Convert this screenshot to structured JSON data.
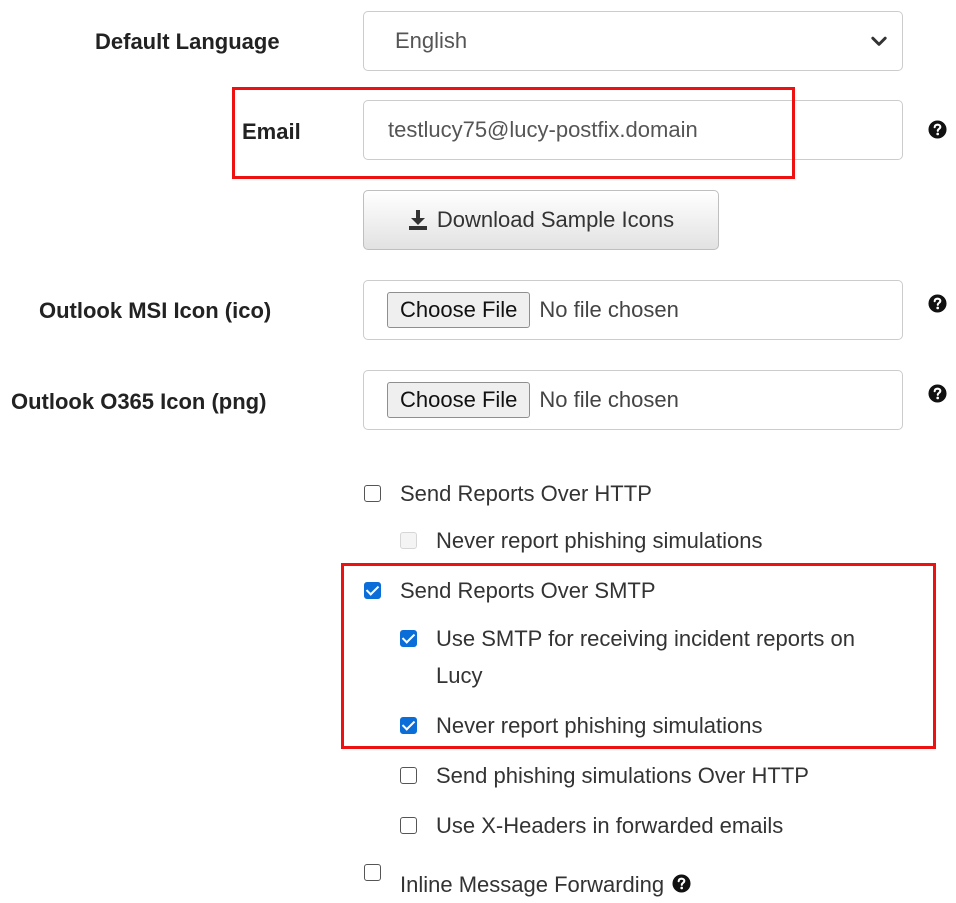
{
  "form": {
    "language": {
      "label": "Default Language",
      "value": "English"
    },
    "email": {
      "label": "Email",
      "value": "testlucy75@lucy-postfix.domain"
    },
    "download_button": {
      "label": "Download Sample Icons",
      "icon": "download-icon"
    },
    "msi_icon": {
      "label": "Outlook MSI Icon (ico)",
      "button": "Choose File",
      "status": "No file chosen"
    },
    "o365_icon": {
      "label": "Outlook O365 Icon (png)",
      "button": "Choose File",
      "status": "No file chosen"
    },
    "options": {
      "send_http": {
        "label": "Send Reports Over HTTP",
        "checked": false
      },
      "http_never_report": {
        "label": "Never report phishing simulations",
        "checked": false,
        "disabled": true
      },
      "send_smtp": {
        "label": "Send Reports Over SMTP",
        "checked": true
      },
      "smtp_incident": {
        "label": "Use SMTP for receiving incident reports on Lucy",
        "checked": true
      },
      "smtp_never_report": {
        "label": "Never report phishing simulations",
        "checked": true
      },
      "send_sim_http": {
        "label": "Send phishing simulations Over HTTP",
        "checked": false
      },
      "x_headers": {
        "label": "Use X-Headers in forwarded emails",
        "checked": false
      },
      "inline_forwarding": {
        "label": "Inline Message Forwarding",
        "checked": false
      }
    }
  },
  "colors": {
    "highlight": "#ee1111",
    "checkbox_checked": "#0b6dd8"
  }
}
